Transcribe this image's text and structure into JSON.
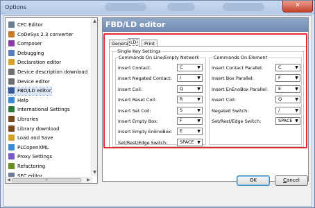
{
  "window": {
    "title": "Options",
    "close_glyph": "✕"
  },
  "tree": {
    "items": [
      {
        "label": "CFC Editor",
        "icon": "cfc-editor-icon",
        "color": "#6b7c93"
      },
      {
        "label": "CoDeSys 2.3 converter",
        "icon": "converter-icon",
        "color": "#c87a2c"
      },
      {
        "label": "Composer",
        "icon": "composer-icon",
        "color": "#8b3ea8"
      },
      {
        "label": "Debugging",
        "icon": "debugging-icon",
        "color": "#5a7fbf"
      },
      {
        "label": "Declaration editor",
        "icon": "declaration-editor-icon",
        "color": "#d6a12a"
      },
      {
        "label": "Device description download",
        "icon": "device-download-icon",
        "color": "#6e6e6e"
      },
      {
        "label": "Device editor",
        "icon": "device-editor-icon",
        "color": "#6e6e6e"
      },
      {
        "label": "FBD/LD editor",
        "icon": "fbd-ld-editor-icon",
        "color": "#3a5d9a"
      },
      {
        "label": "Help",
        "icon": "help-icon",
        "color": "#3b8ad8"
      },
      {
        "label": "International Settings",
        "icon": "globe-icon",
        "color": "#2f7a3c"
      },
      {
        "label": "Libraries",
        "icon": "libraries-icon",
        "color": "#7a4a1e"
      },
      {
        "label": "Library download",
        "icon": "library-download-icon",
        "color": "#7a4a1e"
      },
      {
        "label": "Load and Save",
        "icon": "load-save-icon",
        "color": "#d6a12a"
      },
      {
        "label": "PLCopenXML",
        "icon": "plcopenxml-icon",
        "color": "#3b8ad8"
      },
      {
        "label": "Proxy Settings",
        "icon": "proxy-settings-icon",
        "color": "#7a5ac8"
      },
      {
        "label": "Refactoring",
        "icon": "refactoring-icon",
        "color": "#6b8e23"
      },
      {
        "label": "SFC editor",
        "icon": "sfc-editor-icon",
        "color": "#6b7c93"
      }
    ],
    "selected": "FBD/LD editor",
    "scroll_up": "▲",
    "scroll_down": "▼",
    "scroll_left": "◀",
    "scroll_right": "▶",
    "hthumb_grip": "≡"
  },
  "panel": {
    "title": "FBD/LD editor",
    "tabs": [
      "General",
      "LD",
      "Print"
    ],
    "active_tab": "LD",
    "group_title": "Single Key Settings",
    "left_group": {
      "title": "Commands On Line/Empty Network",
      "rows": [
        {
          "label": "Insert Contact:",
          "value": "C"
        },
        {
          "label": "Insert Negated Contact:",
          "value": "/"
        },
        {
          "label": "Insert Coil:",
          "value": "Q"
        },
        {
          "label": "Insert Reset Coil:",
          "value": "R"
        },
        {
          "label": "Insert Set Coil:",
          "value": "S"
        },
        {
          "label": "Insert Empty Box:",
          "value": "F"
        },
        {
          "label": "Insert Empty EnEnoBox:",
          "value": "E"
        },
        {
          "label": "Set/Rest/Edge Switch:",
          "value": "SPACE"
        }
      ]
    },
    "right_group": {
      "title": "Commands On Element",
      "rows": [
        {
          "label": "Insert Contact Parallel:",
          "value": "C"
        },
        {
          "label": "Insert Box Parallel:",
          "value": "F"
        },
        {
          "label": "Insert EnEnoBox Parallel:",
          "value": "E"
        },
        {
          "label": "Insert Coil:",
          "value": "Q"
        },
        {
          "label": "Negated Switch:",
          "value": "/"
        },
        {
          "label": "Set/Rest/Edge Switch:",
          "value": "SPACE"
        }
      ]
    },
    "dropdown_arrow": "▼"
  },
  "buttons": {
    "ok": "OK",
    "cancel_first": "C",
    "cancel_rest": "ancel"
  },
  "colors": {
    "highlight": "#e3282f",
    "header": "#7f98bb"
  }
}
